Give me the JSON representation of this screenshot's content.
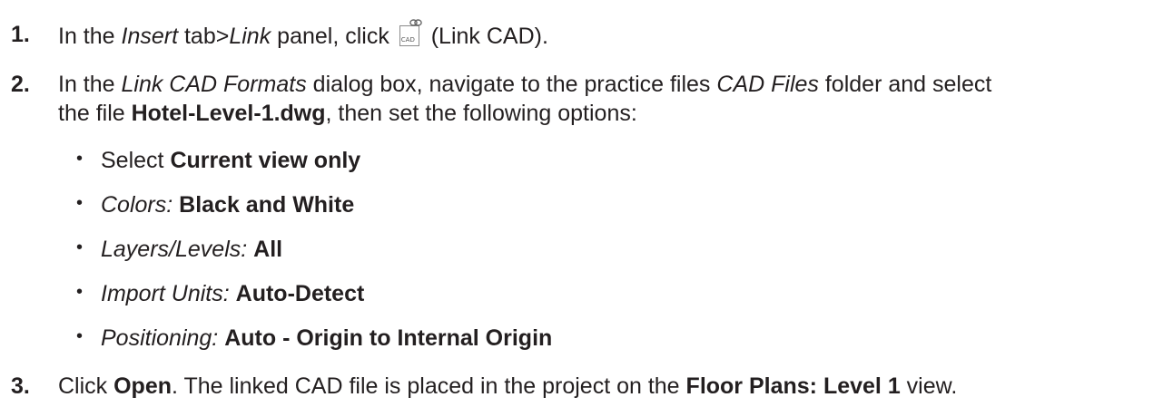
{
  "steps": [
    {
      "number": "1.",
      "parts": {
        "t1": "In the ",
        "i1": "Insert",
        "t2": " tab>",
        "i2": "Link",
        "t3": " panel, click ",
        "t4": " (Link CAD)."
      },
      "icon": {
        "name": "link-cad-icon",
        "label": "CAD"
      }
    },
    {
      "number": "2.",
      "line1": {
        "t1": "In the ",
        "i1": "Link CAD Formats",
        "t2": " dialog box, navigate to the practice files ",
        "i2": "CAD Files",
        "t3": " folder and select"
      },
      "line2": {
        "t1": "the file ",
        "b1": "Hotel-Level-1.dwg",
        "t2": ", then set the following options:"
      },
      "bullets": [
        {
          "prefix": "Select ",
          "label": "",
          "value": "Current view only"
        },
        {
          "prefix": "",
          "label": "Colors:",
          "value": "Black and White"
        },
        {
          "prefix": "",
          "label": "Layers/Levels:",
          "value": "All"
        },
        {
          "prefix": "",
          "label": "Import Units:",
          "value": "Auto-Detect"
        },
        {
          "prefix": "",
          "label": "Positioning:",
          "value": "Auto - Origin to Internal Origin"
        }
      ]
    },
    {
      "number": "3.",
      "parts": {
        "t1": "Click ",
        "b1": "Open",
        "t2": ". The linked CAD file is placed in the project on the ",
        "b2": "Floor Plans: Level 1",
        "t3": " view."
      }
    }
  ],
  "bullet_glyph": "•"
}
